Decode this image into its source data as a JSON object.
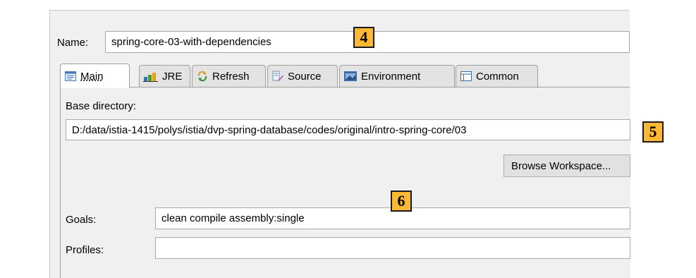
{
  "name": {
    "label": "Name:",
    "value": "spring-core-03-with-dependencies"
  },
  "tabs": [
    {
      "label": "Main",
      "icon": "main-tab-icon"
    },
    {
      "label": "JRE",
      "icon": "jre-icon"
    },
    {
      "label": "Refresh",
      "icon": "refresh-icon"
    },
    {
      "label": "Source",
      "icon": "source-icon"
    },
    {
      "label": "Environment",
      "icon": "environment-icon"
    },
    {
      "label": "Common",
      "icon": "common-icon"
    }
  ],
  "base_directory": {
    "label": "Base directory:",
    "value": "D:/data/istia-1415/polys/istia/dvp-spring-database/codes/original/intro-spring-core/03",
    "browse_label": "Browse Workspace..."
  },
  "goals": {
    "label": "Goals:",
    "value": "clean compile assembly:single"
  },
  "profiles": {
    "label": "Profiles:",
    "value": ""
  },
  "annotations": [
    "4",
    "5",
    "6"
  ],
  "colors": {
    "badge": "#ffb833",
    "tab_border": "#a0a0a0",
    "window_bg": "#f0f0f0"
  }
}
